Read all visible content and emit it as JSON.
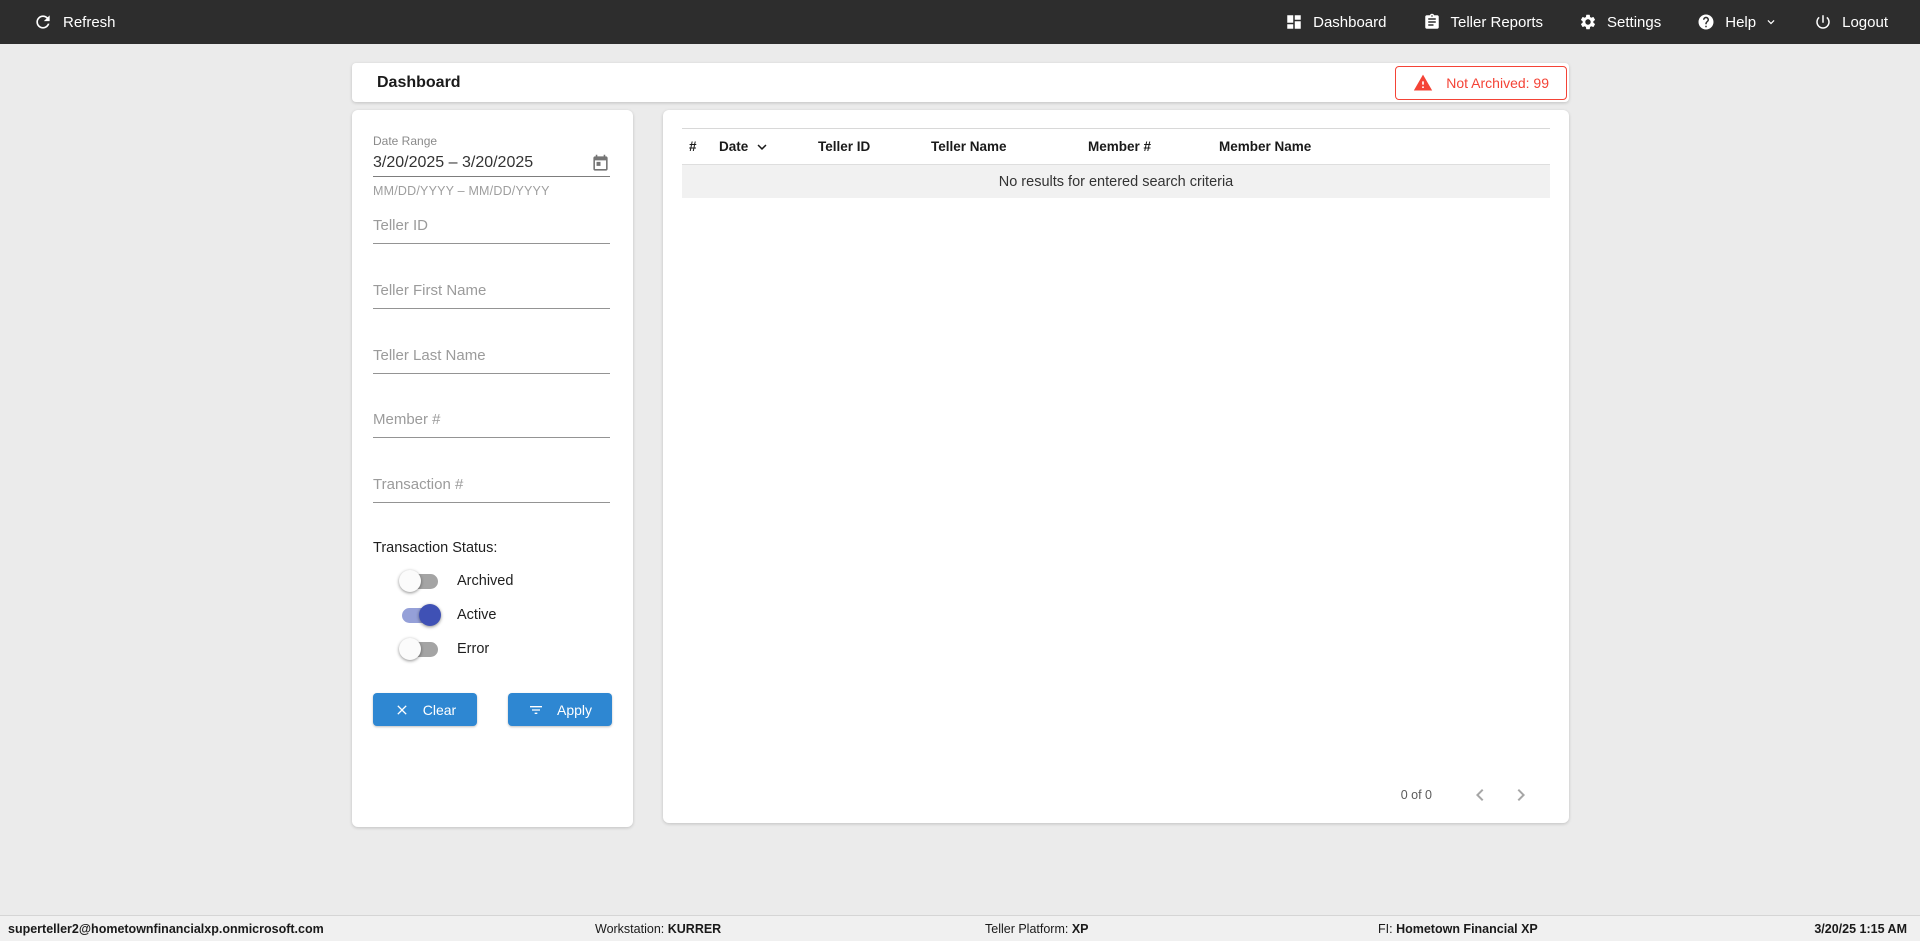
{
  "navbar": {
    "refresh_label": "Refresh",
    "items": [
      {
        "label": "Dashboard",
        "icon": "dashboard-icon"
      },
      {
        "label": "Teller Reports",
        "icon": "clipboard-icon"
      },
      {
        "label": "Settings",
        "icon": "gear-icon"
      },
      {
        "label": "Help",
        "icon": "help-icon",
        "has_dropdown": true
      },
      {
        "label": "Logout",
        "icon": "power-icon"
      }
    ]
  },
  "title_bar": {
    "title": "Dashboard",
    "badge_label": "Not Archived: 99"
  },
  "filters": {
    "date_range": {
      "label": "Date Range",
      "value": "3/20/2025 – 3/20/2025",
      "hint": "MM/DD/YYYY – MM/DD/YYYY"
    },
    "teller_id_placeholder": "Teller ID",
    "teller_first_name_placeholder": "Teller First Name",
    "teller_last_name_placeholder": "Teller Last Name",
    "member_number_placeholder": "Member #",
    "transaction_number_placeholder": "Transaction #",
    "status": {
      "label": "Transaction Status:",
      "toggles": [
        {
          "label": "Archived",
          "on": false
        },
        {
          "label": "Active",
          "on": true
        },
        {
          "label": "Error",
          "on": false
        }
      ]
    },
    "buttons": {
      "clear": "Clear",
      "apply": "Apply"
    }
  },
  "table": {
    "columns": [
      "#",
      "Date",
      "Teller ID",
      "Teller Name",
      "Member #",
      "Member Name"
    ],
    "sorted_by": "Date",
    "sort_direction": "desc",
    "empty_message": "No results for entered search criteria",
    "pagination": {
      "range_label": "0 of 0"
    }
  },
  "status_bar": {
    "user": "superteller2@hometownfinancialxp.onmicrosoft.com",
    "workstation_label": "Workstation:",
    "workstation_value": "KURRER",
    "platform_label": "Teller Platform:",
    "platform_value": "XP",
    "fi_label": "FI:",
    "fi_value": "Hometown Financial XP",
    "datetime": "3/20/25 1:15 AM"
  },
  "colors": {
    "navbar_bg": "#2d2d2d",
    "accent_blue": "#2e87d2",
    "alert_red": "#f44336",
    "toggle_active": "#3f51b5",
    "page_bg": "#ebebeb"
  }
}
